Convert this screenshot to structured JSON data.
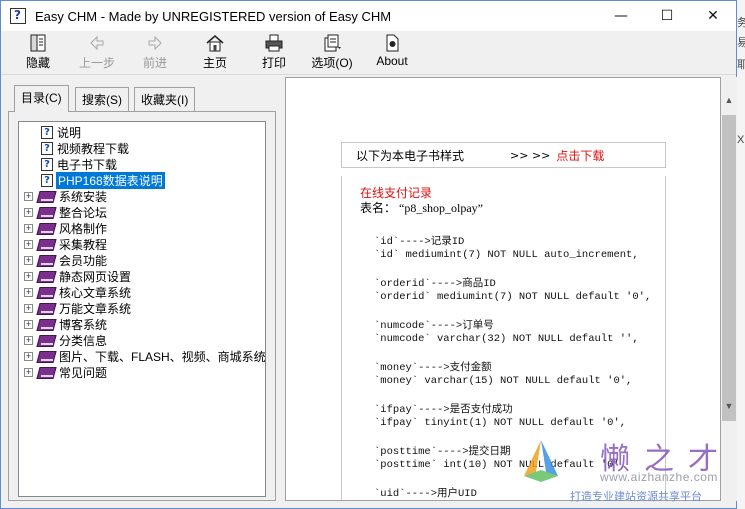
{
  "window": {
    "title": "Easy CHM - Made by UNREGISTERED version of Easy CHM",
    "controls": {
      "minimize": "—",
      "maximize": "☐",
      "close": "✕"
    }
  },
  "toolbar": {
    "buttons": [
      {
        "label": "隐藏",
        "icon": "hide-icon",
        "enabled": true
      },
      {
        "label": "上一步",
        "icon": "back-arrow-icon",
        "enabled": false
      },
      {
        "label": "前进",
        "icon": "forward-arrow-icon",
        "enabled": false
      },
      {
        "label": "主页",
        "icon": "home-icon",
        "enabled": true
      },
      {
        "label": "打印",
        "icon": "printer-icon",
        "enabled": true
      },
      {
        "label": "选项(O)",
        "icon": "options-icon",
        "enabled": true
      },
      {
        "label": "About",
        "icon": "about-icon",
        "enabled": true
      }
    ]
  },
  "tabs": [
    {
      "label": "目录(C)",
      "active": true
    },
    {
      "label": "搜索(S)",
      "active": false
    },
    {
      "label": "收藏夹(I)",
      "active": false
    }
  ],
  "tree": {
    "pages": [
      {
        "label": "说明",
        "selected": false
      },
      {
        "label": "视频教程下载",
        "selected": false
      },
      {
        "label": "电子书下载",
        "selected": false
      },
      {
        "label": "PHP168数据表说明",
        "selected": true
      }
    ],
    "books": [
      "系统安装",
      "整合论坛",
      "风格制作",
      "采集教程",
      "会员功能",
      "静态网页设置",
      "核心文章系统",
      "万能文章系统",
      "博客系统",
      "分类信息",
      "图片、下载、FLASH、视频、商城系统",
      "常见问题"
    ],
    "expander_symbol": "+"
  },
  "content": {
    "banner": {
      "text": "以下为本电子书样式",
      "arrows": ">> >>",
      "link": "点击下载"
    },
    "heading": "在线支付记录",
    "table_label": "表名：",
    "table_name": "“p8_shop_olpay”",
    "fields": [
      {
        "desc": "`id`---->记录ID",
        "def": "`id` mediumint(7) NOT NULL auto_increment,"
      },
      {
        "desc": "`orderid`---->商品ID",
        "def": "`orderid` mediumint(7) NOT NULL default '0',"
      },
      {
        "desc": "`numcode`---->订单号",
        "def": "`numcode` varchar(32) NOT NULL default '',"
      },
      {
        "desc": "`money`---->支付金额",
        "def": "`money` varchar(15) NOT NULL default '0',"
      },
      {
        "desc": "`ifpay`---->是否支付成功",
        "def": "`ifpay` tinyint(1) NOT NULL default '0',"
      },
      {
        "desc": "`posttime`---->提交日期",
        "def": "`posttime` int(10) NOT NULL default '0',"
      },
      {
        "desc": "`uid`---->用户UID",
        "def": ""
      }
    ]
  },
  "scrollbar": {
    "up": "▲",
    "down": "▼"
  },
  "watermark": {
    "title": "懒之才",
    "url": "www.aizhanzhe.com",
    "slogan": "打造专业建站资源共享平台"
  },
  "background": {
    "chars": [
      "务",
      "易",
      "耶",
      "X"
    ]
  },
  "colors": {
    "accent": "#0078d7",
    "link": "#e01010",
    "book": "#7a2f8f"
  }
}
